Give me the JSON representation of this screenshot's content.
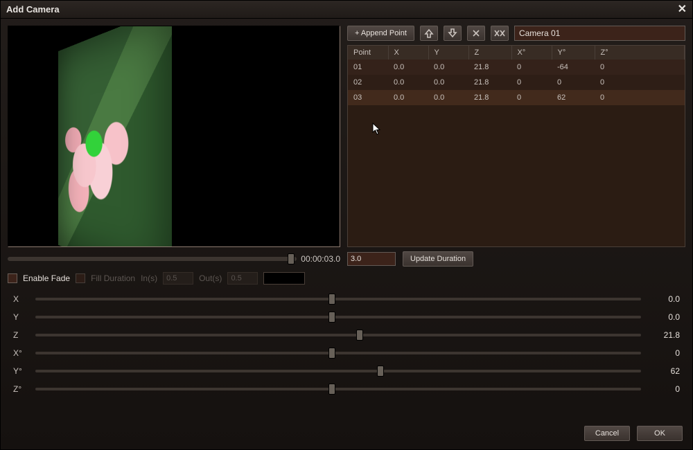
{
  "title": "Add Camera",
  "toolbar": {
    "append_label": "+ Append Point",
    "camera_name": "Camera 01"
  },
  "table": {
    "headers": [
      "Point",
      "X",
      "Y",
      "Z",
      "X°",
      "Y°",
      "Z°"
    ],
    "rows": [
      {
        "point": "01",
        "x": "0.0",
        "y": "0.0",
        "z": "21.8",
        "xd": "0",
        "yd": "-64",
        "zd": "0"
      },
      {
        "point": "02",
        "x": "0.0",
        "y": "0.0",
        "z": "21.8",
        "xd": "0",
        "yd": "0",
        "zd": "0"
      },
      {
        "point": "03",
        "x": "0.0",
        "y": "0.0",
        "z": "21.8",
        "xd": "0",
        "yd": "62",
        "zd": "0"
      }
    ]
  },
  "timeline": {
    "time_label": "00:00:03.0",
    "duration_value": "3.0",
    "update_label": "Update Duration",
    "thumb_pct": 98
  },
  "fade": {
    "enable_label": "Enable Fade",
    "fill_label": "Fill Duration",
    "in_label": "In(s)",
    "in_value": "0.5",
    "out_label": "Out(s)",
    "out_value": "0.5",
    "enabled": false
  },
  "sliders": [
    {
      "label": "X",
      "value": "0.0",
      "pct": 49
    },
    {
      "label": "Y",
      "value": "0.0",
      "pct": 49
    },
    {
      "label": "Z",
      "value": "21.8",
      "pct": 53.5
    },
    {
      "label": "X°",
      "value": "0",
      "pct": 49
    },
    {
      "label": "Y°",
      "value": "62",
      "pct": 57
    },
    {
      "label": "Z°",
      "value": "0",
      "pct": 49
    }
  ],
  "footer": {
    "cancel": "Cancel",
    "ok": "OK"
  }
}
